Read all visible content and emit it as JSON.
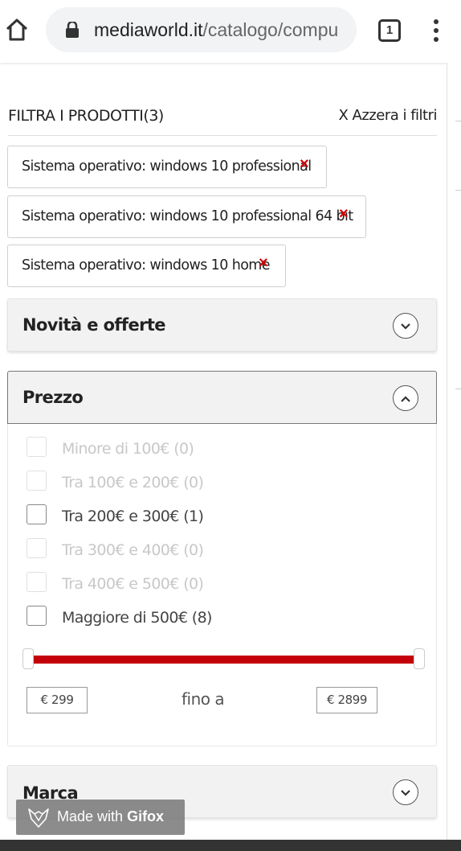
{
  "browser": {
    "url_domain": "mediaworld.it",
    "url_path": "/catalogo/compu",
    "tab_count": "1"
  },
  "filters": {
    "title": "FILTRA I PRODOTTI(3)",
    "reset_label": "X Azzera i filtri",
    "chips": [
      {
        "label": "Sistema operativo: windows 10 professional",
        "remove": "×"
      },
      {
        "label": "Sistema operativo: windows 10 professional 64 bit",
        "remove": "×"
      },
      {
        "label": "Sistema operativo: windows 10 home",
        "remove": "×"
      }
    ]
  },
  "accordions": {
    "offers": {
      "title": "Novità e offerte"
    },
    "price": {
      "title": "Prezzo"
    },
    "brand": {
      "title": "Marca"
    }
  },
  "price": {
    "options": [
      {
        "label": "Minore di 100€ (0)",
        "enabled": false
      },
      {
        "label": "Tra 100€ e 200€ (0)",
        "enabled": false
      },
      {
        "label": "Tra 200€ e 300€ (1)",
        "enabled": true
      },
      {
        "label": "Tra 300€ e 400€ (0)",
        "enabled": false
      },
      {
        "label": "Tra 400€ e 500€ (0)",
        "enabled": false
      },
      {
        "label": "Maggiore di 500€ (8)",
        "enabled": true
      }
    ],
    "min_value": "€ 299",
    "max_value": "€ 2899",
    "range_label": "fino a",
    "slider_color": "#c4000b"
  },
  "overlay": {
    "prefix": "Made with",
    "brand": "Gifox"
  },
  "colors": {
    "remove_red": "#d40000"
  }
}
